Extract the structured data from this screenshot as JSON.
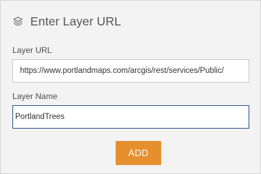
{
  "header": {
    "icon": "layers-icon",
    "title": "Enter Layer URL"
  },
  "layer_url": {
    "label": "Layer URL",
    "value": "https://www.portlandmaps.com/arcgis/rest/services/Public/"
  },
  "layer_name": {
    "label": "Layer Name",
    "value": "PortlandTrees"
  },
  "add_button": {
    "label": "ADD"
  },
  "colors": {
    "panel_background": "#f3f3f3",
    "button_accent": "#e58f2e",
    "focused_input_border": "#1f4e8a"
  }
}
